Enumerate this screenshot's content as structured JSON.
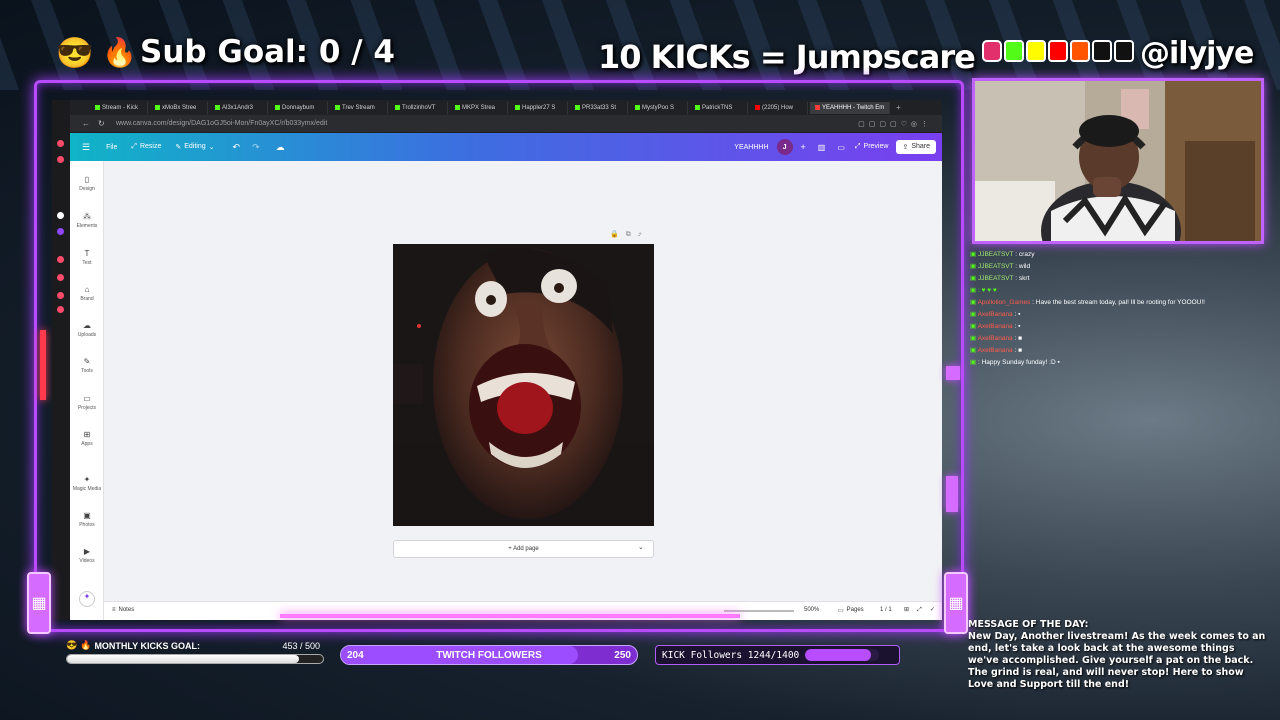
{
  "overlay": {
    "sub_goal": "Sub Goal:  0 / 4",
    "kick_title": "10 KICKs = Jumpscare",
    "handle": "@ilyjye",
    "monthly_goal_label": "MONTHLY KICKS GOAL:",
    "monthly_goal_value": "453  / 500",
    "monthly_goal_fraction": 0.906,
    "twitch_left": "204",
    "twitch_label": "TWITCH FOLLOWERS",
    "twitch_right": "250",
    "twitch_fraction": 0.8,
    "kick_followers": "KICK Followers 1244/1400",
    "kick_fraction": 0.889,
    "motd_title": "MESSAGE OF THE DAY:",
    "motd_text": "New Day, Another livestream! As the week comes to an end, let's take a look back at the awesome things we've accomplished. Give yourself a pat on the back. The grind is real, and will never stop! Here to show Love and Support till the end!"
  },
  "browser": {
    "tabs": [
      "Stream - Kick",
      "xMoBx Stree",
      "Al3x1Andr3",
      "Donnaybum",
      "Trev Stream",
      "TrollzinhoVT",
      "MKPX Strea",
      "Happler27 S",
      "PR33at33 St",
      "MystyPoo S",
      "PatrickTNS",
      "(2205) How",
      "YEAHHHH - Twitch Em"
    ],
    "url": "www.canva.com/design/DAG1oGJ5oi-Mon/Fn0ayXC/r/b033ymx/edit"
  },
  "canva": {
    "menu": {
      "file": "File",
      "resize": "Resize",
      "editing": "Editing"
    },
    "design_name": "YEAHHHH",
    "avatar_initial": "J",
    "preview": "Preview",
    "share": "Share",
    "rail": [
      "Design",
      "Elements",
      "Text",
      "Brand",
      "Uploads",
      "Tools",
      "Projects",
      "Apps",
      "Magic Media",
      "Photos",
      "Videos"
    ],
    "add_page": "+ Add page",
    "notes": "Notes",
    "zoom": "500%",
    "pages": "Pages",
    "page_count": "1 / 1"
  },
  "chat": [
    {
      "user": "JJBEATSVT",
      "msg": ": crazy"
    },
    {
      "user": "JJBEATSVT",
      "msg": ": wild"
    },
    {
      "user": "JJBEATSVT",
      "msg": ": skrt"
    },
    {
      "user": "",
      "msg": ": ♥ ♥ ♥"
    },
    {
      "user": "Apollolion_Games",
      "msg": ": Have the best stream today, pal! Ill be rooting for YOOOU!!"
    },
    {
      "user": "AxelBanana",
      "msg": ":"
    },
    {
      "user": "AxelBanana",
      "msg": ":"
    },
    {
      "user": "AxelBanana",
      "msg": ":"
    },
    {
      "user": "AxelBanana",
      "msg": ":"
    },
    {
      "user": "",
      "msg": ": Happy Sunday funday! :D"
    }
  ],
  "colors": {
    "neon": "#b94bff",
    "twitch": "#7d2dd0",
    "kick": "#53fc18"
  }
}
